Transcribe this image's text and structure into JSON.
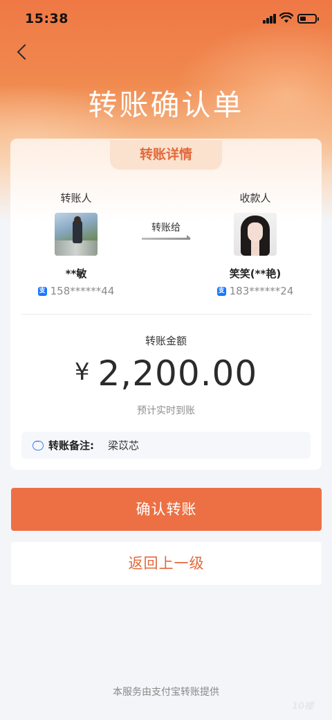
{
  "status_bar": {
    "time": "15:38"
  },
  "header": {
    "title": "转账确认单"
  },
  "card": {
    "tab_label": "转账详情",
    "sender": {
      "role": "转账人",
      "name": "**敏",
      "account": "158******44"
    },
    "receiver": {
      "role": "收款人",
      "name": "笑笑(**艳)",
      "account": "183******24"
    },
    "transfer_label": "转账给",
    "amount_label": "转账金额",
    "currency_symbol": "¥",
    "amount": "2,200.00",
    "eta": "预计实时到账",
    "remark": {
      "label": "转账备注:",
      "value": "梁苡芯"
    }
  },
  "actions": {
    "confirm": "确认转账",
    "back": "返回上一级"
  },
  "footer": {
    "text": "本服务由支付宝转账提供"
  },
  "watermark": {
    "text": "10楼"
  },
  "colors": {
    "accent": "#ec7043",
    "tab_text": "#e2693a",
    "alipay_blue": "#1677ff"
  }
}
